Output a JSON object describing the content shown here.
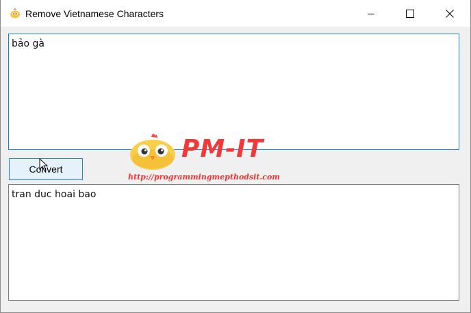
{
  "window": {
    "title": "Remove Vietnamese Characters"
  },
  "input": {
    "value": "bảo gà"
  },
  "convert_button": {
    "label": "Convert"
  },
  "output": {
    "value": "tran duc hoai bao"
  },
  "watermark": {
    "logo_text": "PM-IT",
    "url": "http://programmingmepthodsit.com"
  },
  "colors": {
    "accent_border": "#1e7ad4",
    "button_bg": "#e5f1fb",
    "watermark_red": "#f03a3a"
  },
  "icons": [
    "app-icon",
    "minimize-icon",
    "maximize-icon",
    "close-icon",
    "mouse-cursor-icon"
  ]
}
